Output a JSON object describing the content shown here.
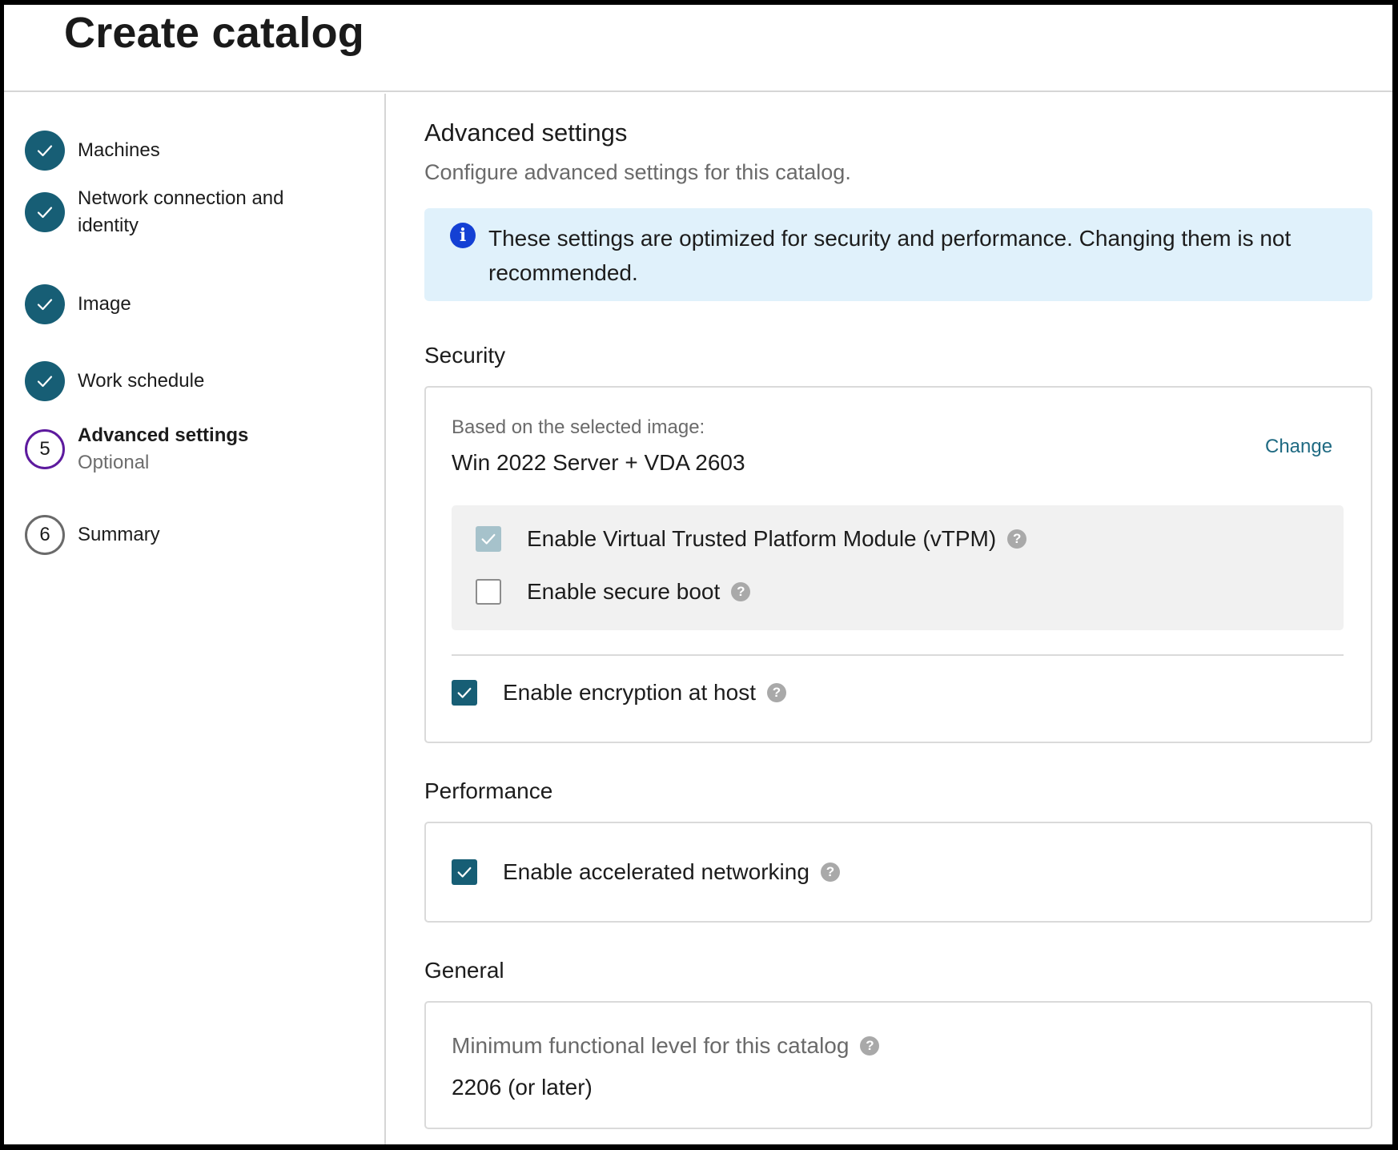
{
  "header": {
    "title": "Create catalog"
  },
  "sidebar": {
    "steps": [
      {
        "label": "Machines",
        "state": "done"
      },
      {
        "label": "Network connection and",
        "label2": "identity",
        "state": "done"
      },
      {
        "label": "Image",
        "state": "done"
      },
      {
        "label": "Work schedule",
        "state": "done"
      },
      {
        "number": "5",
        "label": "Advanced settings",
        "sub": "Optional",
        "state": "current"
      },
      {
        "number": "6",
        "label": "Summary",
        "state": "pending"
      }
    ]
  },
  "main": {
    "title": "Advanced settings",
    "subtitle": "Configure advanced settings for this catalog.",
    "info": "These settings are optimized for security and performance. Changing them is not recommended.",
    "security": {
      "heading": "Security",
      "based_on_label": "Based on the selected image:",
      "image_name": "Win 2022 Server + VDA 2603",
      "change_label": "Change",
      "vtpm_label": "Enable Virtual Trusted Platform Module (vTPM)",
      "secure_boot_label": "Enable secure boot",
      "encryption_label": "Enable encryption at host"
    },
    "performance": {
      "heading": "Performance",
      "accel_label": "Enable accelerated networking"
    },
    "general": {
      "heading": "General",
      "min_level_label": "Minimum functional level for this catalog",
      "min_level_value": "2206 (or later)"
    }
  },
  "icons": {
    "check": "check-icon",
    "info": "info-icon",
    "help": "help-icon"
  },
  "colors": {
    "accent": "#175e75",
    "current_step": "#5d1a9e",
    "info_bg": "#e0f1fb",
    "info_icon": "#1440d4",
    "link": "#1f6a82"
  }
}
